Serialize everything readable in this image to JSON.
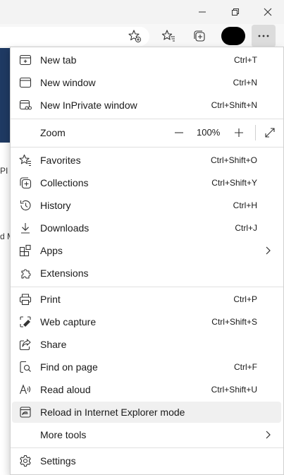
{
  "window": {
    "controls": [
      "minimize-icon",
      "restore-icon",
      "close-icon"
    ]
  },
  "toolbar": {
    "icons": [
      "add-favorite-icon",
      "favorites-icon",
      "collections-icon",
      "profile-avatar",
      "more-icon"
    ]
  },
  "page": {
    "fragments": [
      "PI I",
      "d M"
    ]
  },
  "menu": {
    "new_tab": {
      "label": "New tab",
      "shortcut": "Ctrl+T",
      "icon": "new-tab-icon"
    },
    "new_window": {
      "label": "New window",
      "shortcut": "Ctrl+N",
      "icon": "new-window-icon"
    },
    "new_inprivate": {
      "label": "New InPrivate window",
      "shortcut": "Ctrl+Shift+N",
      "icon": "inprivate-icon"
    },
    "zoom": {
      "label": "Zoom",
      "value": "100%",
      "minus": "—",
      "plus": "+"
    },
    "favorites": {
      "label": "Favorites",
      "shortcut": "Ctrl+Shift+O",
      "icon": "favorites-icon"
    },
    "collections": {
      "label": "Collections",
      "shortcut": "Ctrl+Shift+Y",
      "icon": "collections-icon"
    },
    "history": {
      "label": "History",
      "shortcut": "Ctrl+H",
      "icon": "history-icon"
    },
    "downloads": {
      "label": "Downloads",
      "shortcut": "Ctrl+J",
      "icon": "download-icon"
    },
    "apps": {
      "label": "Apps",
      "icon": "apps-icon"
    },
    "extensions": {
      "label": "Extensions",
      "icon": "extensions-icon"
    },
    "print": {
      "label": "Print",
      "shortcut": "Ctrl+P",
      "icon": "print-icon"
    },
    "web_capture": {
      "label": "Web capture",
      "shortcut": "Ctrl+Shift+S",
      "icon": "web-capture-icon"
    },
    "share": {
      "label": "Share",
      "icon": "share-icon"
    },
    "find_on_page": {
      "label": "Find on page",
      "shortcut": "Ctrl+F",
      "icon": "find-icon"
    },
    "read_aloud": {
      "label": "Read aloud",
      "shortcut": "Ctrl+Shift+U",
      "icon": "read-aloud-icon"
    },
    "reload_ie": {
      "label": "Reload in Internet Explorer mode",
      "icon": "ie-mode-icon"
    },
    "more_tools": {
      "label": "More tools"
    },
    "settings": {
      "label": "Settings",
      "icon": "settings-icon"
    }
  },
  "colors": {
    "menu_bg": "#ffffff",
    "highlight": "#f0f0f0",
    "chrome_bg": "#f3f3f3",
    "page_accent": "#1f3a63"
  }
}
